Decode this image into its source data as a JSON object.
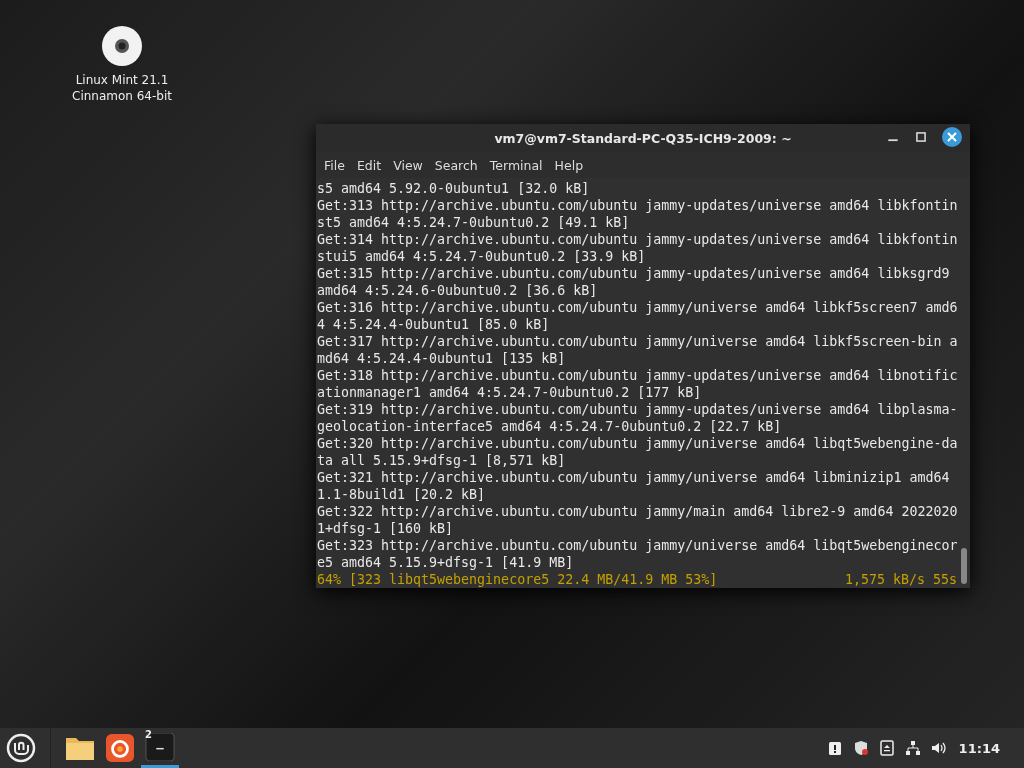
{
  "desktop_icons": [
    {
      "label_lines": [
        "Linux Mint 21.1",
        "Cinnamon 64-bit"
      ]
    }
  ],
  "window": {
    "title": "vm7@vm7-Standard-PC-Q35-ICH9-2009: ~"
  },
  "menu": [
    "File",
    "Edit",
    "View",
    "Search",
    "Terminal",
    "Help"
  ],
  "terminal": {
    "lines": [
      "s5 amd64 5.92.0-0ubuntu1 [32.0 kB]",
      "Get:313 http://archive.ubuntu.com/ubuntu jammy-updates/universe amd64 libkfontin",
      "st5 amd64 4:5.24.7-0ubuntu0.2 [49.1 kB]",
      "Get:314 http://archive.ubuntu.com/ubuntu jammy-updates/universe amd64 libkfontin",
      "stui5 amd64 4:5.24.7-0ubuntu0.2 [33.9 kB]",
      "Get:315 http://archive.ubuntu.com/ubuntu jammy-updates/universe amd64 libksgrd9",
      "amd64 4:5.24.6-0ubuntu0.2 [36.6 kB]",
      "Get:316 http://archive.ubuntu.com/ubuntu jammy/universe amd64 libkf5screen7 amd6",
      "4 4:5.24.4-0ubuntu1 [85.0 kB]",
      "Get:317 http://archive.ubuntu.com/ubuntu jammy/universe amd64 libkf5screen-bin a",
      "md64 4:5.24.4-0ubuntu1 [135 kB]",
      "Get:318 http://archive.ubuntu.com/ubuntu jammy-updates/universe amd64 libnotific",
      "ationmanager1 amd64 4:5.24.7-0ubuntu0.2 [177 kB]",
      "Get:319 http://archive.ubuntu.com/ubuntu jammy-updates/universe amd64 libplasma-",
      "geolocation-interface5 amd64 4:5.24.7-0ubuntu0.2 [22.7 kB]",
      "Get:320 http://archive.ubuntu.com/ubuntu jammy/universe amd64 libqt5webengine-da",
      "ta all 5.15.9+dfsg-1 [8,571 kB]",
      "Get:321 http://archive.ubuntu.com/ubuntu jammy/universe amd64 libminizip1 amd64",
      "1.1-8build1 [20.2 kB]",
      "Get:322 http://archive.ubuntu.com/ubuntu jammy/main amd64 libre2-9 amd64 2022020",
      "1+dfsg-1 [160 kB]",
      "Get:323 http://archive.ubuntu.com/ubuntu jammy/universe amd64 libqt5webenginecor",
      "e5 amd64 5.15.9+dfsg-1 [41.9 MB]"
    ],
    "progress_left": "64% [323 libqt5webenginecore5 22.4 MB/41.9 MB 53%]",
    "progress_right": "1,575 kB/s 55s"
  },
  "taskbar": {
    "apps": [
      {
        "kind": "files",
        "selected": false
      },
      {
        "kind": "firefox",
        "selected": false
      },
      {
        "kind": "terminal",
        "selected": true,
        "badge": "2"
      }
    ],
    "clock": "11:14"
  }
}
